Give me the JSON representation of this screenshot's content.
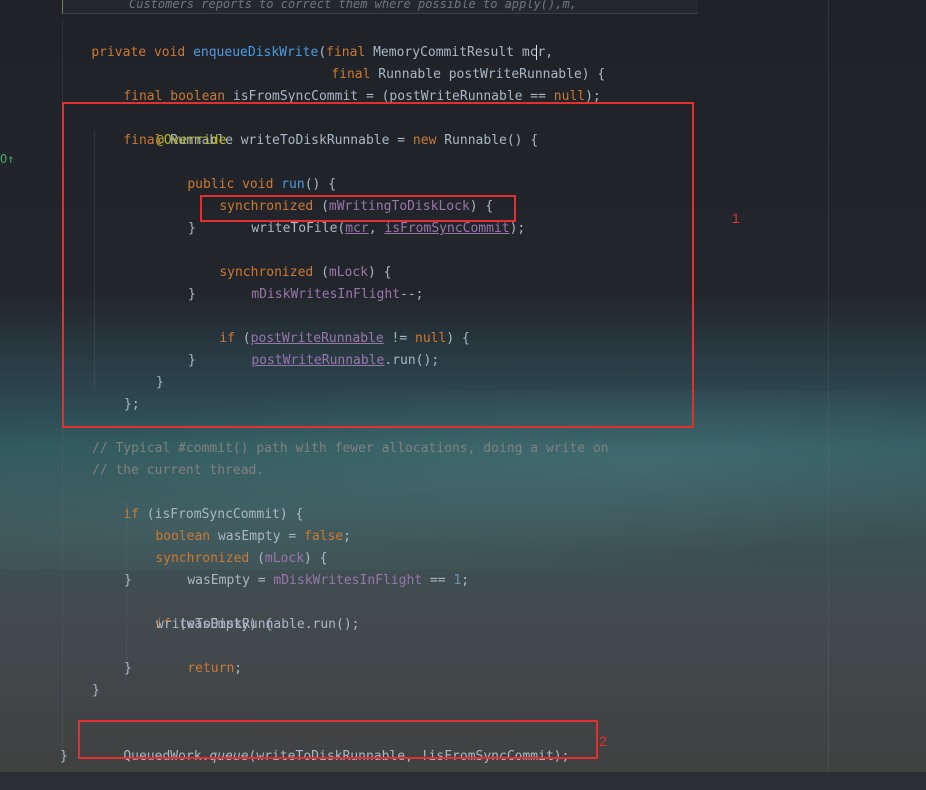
{
  "editor": {
    "top_comment": "Customers reports to correct them where possible to apply(),m,"
  },
  "code_lines": {
    "l1_a": "private ",
    "l1_b": "void ",
    "l1_c": "enqueueDiskWrite",
    "l1_d": "(",
    "l1_e": "final ",
    "l1_f": "MemoryCommitResult mc",
    "l1_g": "r,",
    "l2_a": "final ",
    "l2_b": "Runnable postWriteRunnable) {",
    "l3_a": "final boolean ",
    "l3_b": "isFromSyncCommit = (postWriteRunnable == ",
    "l3_c": "null",
    "l3_d": ");",
    "l4_a": "final ",
    "l4_b": "Runnable writeToDiskRunnable = ",
    "l4_c": "new ",
    "l4_d": "Runnable() {",
    "l5": "@Override",
    "l6_a": "public void ",
    "l6_b": "run",
    "l6_c": "() {",
    "l7_a": "synchronized ",
    "l7_b": "(",
    "l7_c": "mWritingToDiskLock",
    "l7_d": ") {",
    "l8_a": "writeToFile(",
    "l8_b": "mcr",
    "l8_c": ", ",
    "l8_d": "isFromSyncCommit",
    "l8_e": ");",
    "l9": "}",
    "l10_a": "synchronized ",
    "l10_b": "(",
    "l10_c": "mLock",
    "l10_d": ") {",
    "l11_a": "mDiskWritesInFlight",
    "l11_b": "--;",
    "l12": "}",
    "l13_a": "if ",
    "l13_b": "(",
    "l13_c": "postWriteRunnable",
    "l13_d": " != ",
    "l13_e": "null",
    "l13_f": ") {",
    "l14_a": "postWriteRunnable",
    "l14_b": ".run();",
    "l15": "}",
    "l16": "}",
    "l17": "};",
    "l18": "// Typical #commit() path with fewer allocations, doing a write on",
    "l19": "// the current thread.",
    "l20_a": "if ",
    "l20_b": "(isFromSyncCommit) {",
    "l21_a": "boolean ",
    "l21_b": "wasEmpty = ",
    "l21_c": "false",
    "l21_d": ";",
    "l22_a": "synchronized ",
    "l22_b": "(",
    "l22_c": "mLock",
    "l22_d": ") {",
    "l23_a": "wasEmpty = ",
    "l23_b": "mDiskWritesInFlight",
    "l23_c": " == ",
    "l23_d": "1",
    "l23_e": ";",
    "l24": "}",
    "l25_a": "if ",
    "l25_b": "(wasEmpty) {",
    "l26": "writeToDiskRunnable.run();",
    "l27_a": "return",
    "l27_b": ";",
    "l28": "}",
    "l29": "}",
    "l30_a": "QueuedWork.",
    "l30_b": "queue",
    "l30_c": "(writeToDiskRunnable, !isFromSyncCommit);",
    "l31": "}"
  },
  "annotations": {
    "label_1": "1",
    "label_2": "2",
    "box_color": "#e03030"
  },
  "gutter": {
    "override_marker": "O↑"
  }
}
